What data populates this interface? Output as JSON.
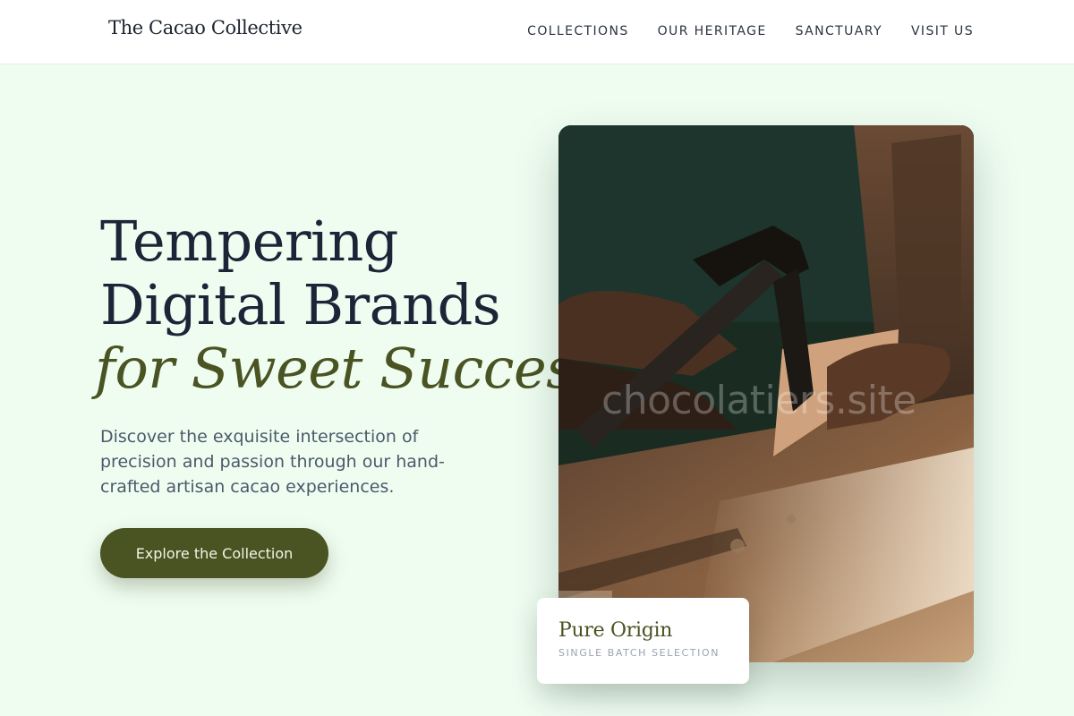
{
  "header": {
    "brand": "The Cacao Collective",
    "nav": [
      "COLLECTIONS",
      "OUR HERITAGE",
      "SANCTUARY",
      "VISIT US"
    ]
  },
  "hero": {
    "title_lines": [
      "Tempering",
      "Digital Brands"
    ],
    "title_accent": "for Sweet Success",
    "description": "Discover the exquisite intersection of precision and passion through our hand-crafted artisan cacao experiences.",
    "cta_label": "Explore the Collection"
  },
  "image": {
    "watermark": "chocolatiers.site"
  },
  "card": {
    "title": "Pure Origin",
    "subtitle": "SINGLE BATCH SELECTION"
  },
  "colors": {
    "background": "#effdf1",
    "accent": "#4a5322",
    "heading": "#1c2538",
    "body_text": "#4a5a6a"
  },
  "icons": [
    "hammer-illustration"
  ]
}
